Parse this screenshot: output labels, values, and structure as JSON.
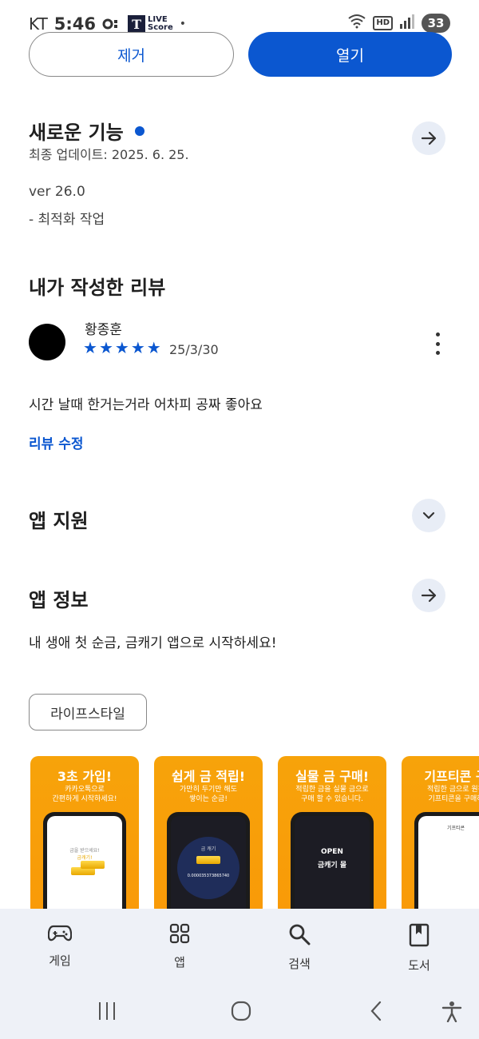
{
  "status_bar": {
    "carrier": "KT",
    "time": "5:46",
    "live_badge_letter": "T",
    "live_badge_text_1": "LIVE",
    "live_badge_text_2": "Score",
    "hd": "HD",
    "battery": "33"
  },
  "actions": {
    "remove_label": "제거",
    "open_label": "열기"
  },
  "whats_new": {
    "title": "새로운 기능",
    "last_updated": "최종 업데이트: 2025. 6. 25.",
    "version": "ver 26.0",
    "note": "- 최적화 작업"
  },
  "my_review": {
    "title": "내가 작성한 리뷰",
    "reviewer": "황종훈",
    "rating": 5,
    "date": "25/3/30",
    "body": "시간 날때 한거는거라 어차피 공짜 좋아요",
    "edit_label": "리뷰 수정"
  },
  "app_support": {
    "title": "앱 지원"
  },
  "app_info": {
    "title": "앱 정보",
    "description": "내 생애 첫 순금, 금캐기 앱으로 시작하세요!",
    "category_chip": "라이프스타일"
  },
  "screenshots": [
    {
      "title": "3초 가입!",
      "subtitle_1": "카카오톡으로",
      "subtitle_2": "간편하게 시작하세요!",
      "screen_line_1": "금을 받으세요!",
      "screen_line_2": "금캐기!"
    },
    {
      "title": "쉽게 금 적립!",
      "subtitle_1": "가만히 두기만 해도",
      "subtitle_2": "쌓이는 순금!",
      "screen_line_1": "0.000035373865740",
      "screen_line_2": "금 캐기"
    },
    {
      "title": "실물 금 구매!",
      "subtitle_1": "적립한 금을 실물 금으로",
      "subtitle_2": "구매 할 수 있습니다.",
      "screen_line_1": "OPEN",
      "screen_line_2": "금캐기 몰"
    },
    {
      "title": "기프티콘 구",
      "subtitle_1": "적립한 금으로 원하",
      "subtitle_2": "기프티콘을 구매하",
      "screen_line_1": "기프티콘",
      "screen_line_2": ""
    }
  ],
  "bottom_nav": [
    {
      "label": "게임",
      "icon": "gamepad-icon"
    },
    {
      "label": "앱",
      "icon": "apps-grid-icon"
    },
    {
      "label": "검색",
      "icon": "search-icon"
    },
    {
      "label": "도서",
      "icon": "book-icon"
    }
  ],
  "colors": {
    "accent": "#0b57d0",
    "nav_bg": "#eef1f7",
    "screenshot_bg": "#f7a30a"
  }
}
